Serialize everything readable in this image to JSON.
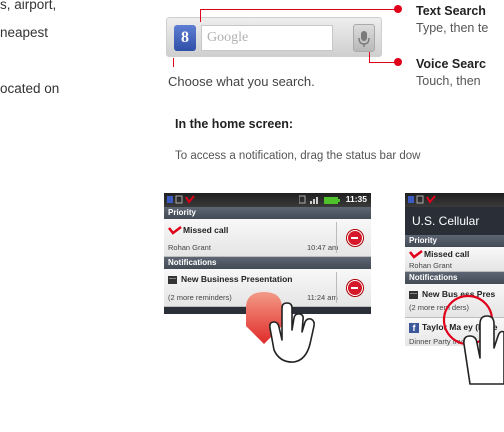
{
  "left_column": {
    "line1": "s, airport,",
    "line2": "neapest",
    "line3": "ocated on"
  },
  "search_widget": {
    "google_button": "8",
    "placeholder": "Google"
  },
  "callouts": {
    "text_search_title": "Text Search",
    "text_search_body": "Type, then te",
    "voice_search_title": "Voice Searc",
    "voice_search_body": "Touch, then",
    "caption": "Choose what you search."
  },
  "section": {
    "heading": "In the home screen:",
    "paragraph": "To access a notification, drag the status bar dow"
  },
  "phone1": {
    "time": "11:35",
    "priority_header": "Priority",
    "missed_call_title": "Missed call",
    "missed_call_name": "Rohan Grant",
    "missed_call_time": "10:47 am",
    "notifications_header": "Notifications",
    "presentation_title": "New Business Presentation",
    "presentation_sub": "(2 more reminders)",
    "presentation_time": "11:24 am"
  },
  "phone2": {
    "carrier": "U.S. Cellular",
    "priority_header": "Priority",
    "missed_call_title": "Missed call",
    "missed_call_name": "Rohan Grant",
    "notifications_header": "Notifications",
    "presentation_title": "New Bus   ess Pres",
    "presentation_sub": "(2 more rem   ders)",
    "facebook_title": "Taylor Ma    ey (Face",
    "facebook_sub": "Dinner Party Invite"
  },
  "colors": {
    "accent_red": "#e0001a",
    "google_blue": "#3b5bc0",
    "phone_dark": "#2b3038",
    "notification_red": "#d7182a"
  }
}
